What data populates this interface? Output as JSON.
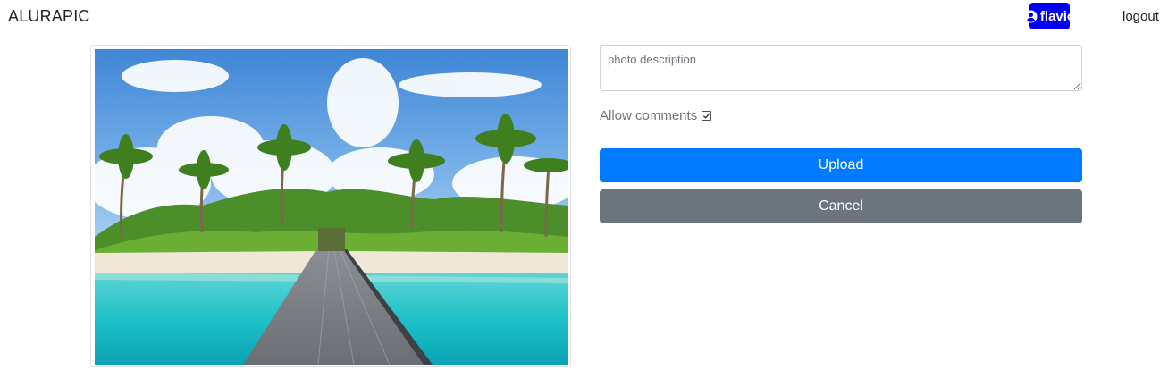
{
  "navbar": {
    "brand": "ALURAPIC",
    "user": {
      "name": "flavio",
      "icon": "user-circle-icon"
    },
    "logout_label": "logout"
  },
  "form": {
    "description_placeholder": "photo description",
    "allow_comments_label": "Allow comments",
    "allow_comments_checked": true,
    "upload_label": "Upload",
    "cancel_label": "Cancel"
  },
  "colors": {
    "user_badge": "#0000ee",
    "upload_button": "#007bff",
    "cancel_button": "#6c757d"
  }
}
